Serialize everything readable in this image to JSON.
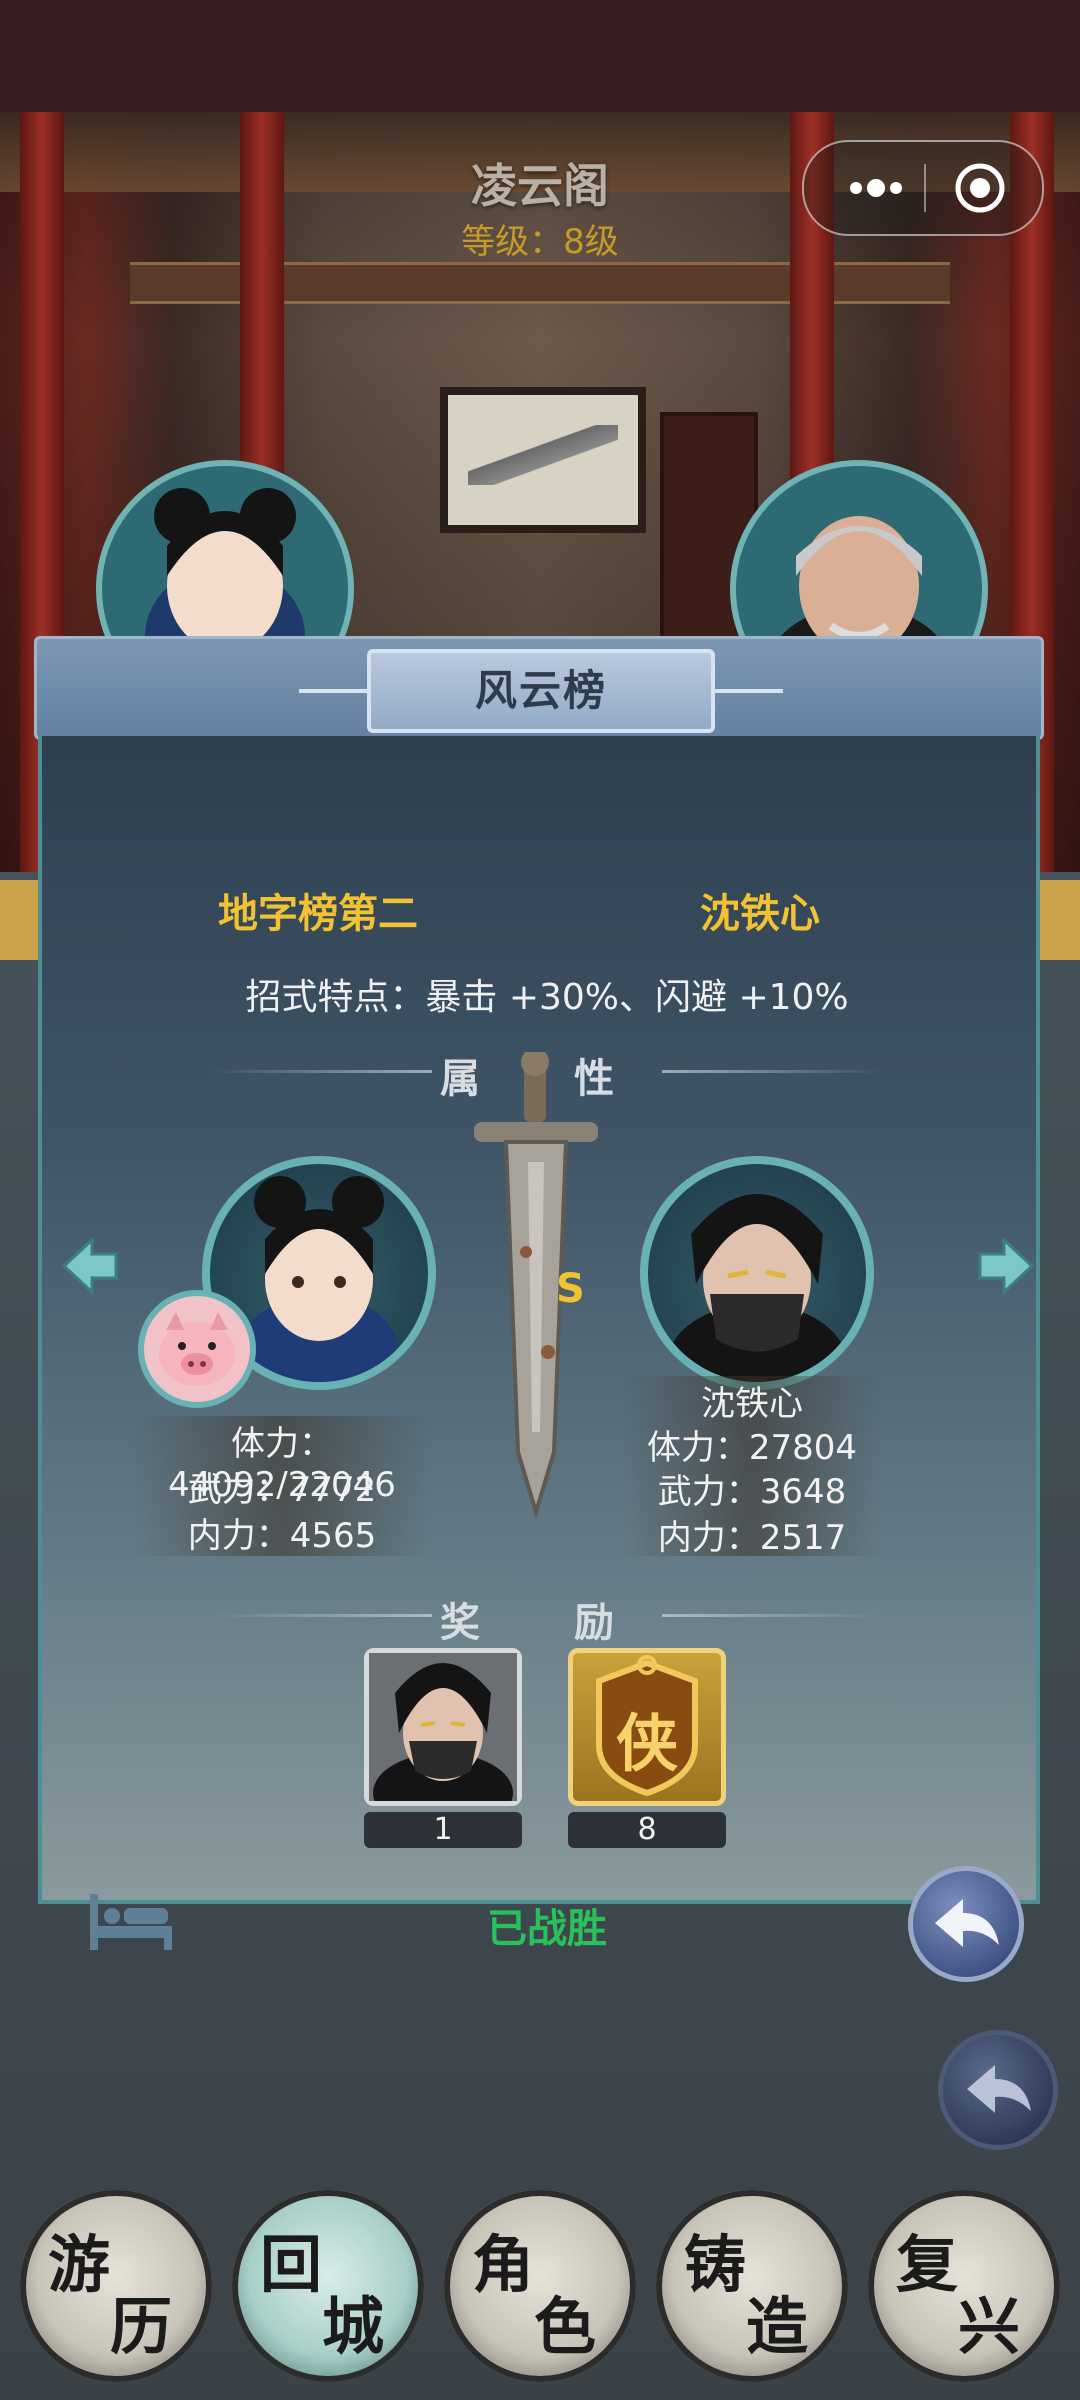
{
  "scene": {
    "title": "凌云阁",
    "level": "等级：8级"
  },
  "miniprogram": {
    "more_icon": "more-dots-icon",
    "close_icon": "target-circle-icon"
  },
  "dialog": {
    "title": "风云榜",
    "rank": "地字榜第二",
    "opponent_name": "沈铁心",
    "feature": "招式特点：暴击 +30%、闪避 +10%",
    "attributes_title": "属 性",
    "grade": "S",
    "player": {
      "hp": "体力：44092/22046",
      "atk": "武力：7772",
      "inner": "内力：4565"
    },
    "opponent": {
      "name": "沈铁心",
      "hp": "体力：27804",
      "atk": "武力：3648",
      "inner": "内力：2517"
    },
    "rewards_title": "奖 励",
    "rewards": [
      {
        "icon": "masked-swordsman-portrait-icon",
        "count": "1"
      },
      {
        "icon": "xia-badge-icon",
        "glyph": "侠",
        "count": "8"
      }
    ],
    "status": "已战胜",
    "colors": {
      "gold": "#f2c232",
      "green": "#27c25a",
      "teal_border": "#68b2b4"
    }
  },
  "nav": [
    {
      "char1": "游",
      "char2": "历",
      "active": false
    },
    {
      "char1": "回",
      "char2": "城",
      "active": true
    },
    {
      "char1": "角",
      "char2": "色",
      "active": false
    },
    {
      "char1": "铸",
      "char2": "造",
      "active": false
    },
    {
      "char1": "复",
      "char2": "兴",
      "active": false
    }
  ]
}
